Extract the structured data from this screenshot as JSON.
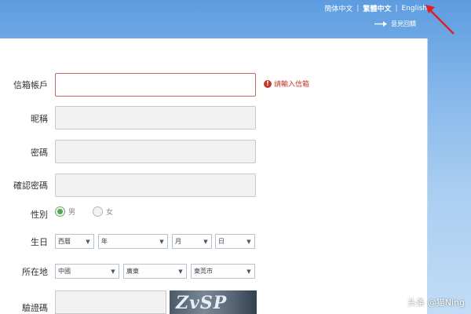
{
  "languages": [
    "簡体中文",
    "繁體中文",
    "English"
  ],
  "active_language": "繁體中文",
  "feedback_label": "意見回饋",
  "form": {
    "email_label": "信箱帳戶",
    "email_hint": "請輸入信箱",
    "nickname_label": "昵稱",
    "password_label": "密碼",
    "confirm_password_label": "確認密碼",
    "gender_label": "性別",
    "gender_male": "男",
    "gender_female": "女",
    "birthday_label": "生日",
    "birthday_era": "西曆",
    "birthday_year": "年",
    "birthday_month": "月",
    "birthday_day": "日",
    "location_label": "所在地",
    "location_country": "中國",
    "location_province": "廣東",
    "location_city": "東莞市",
    "captcha_label": "驗證碼",
    "captcha_text": "ZvSP"
  },
  "watermark": "头条 @猫Ning",
  "colors": {
    "accent": "#5d9ce0",
    "error": "#c0392b",
    "checked": "#55a655"
  }
}
